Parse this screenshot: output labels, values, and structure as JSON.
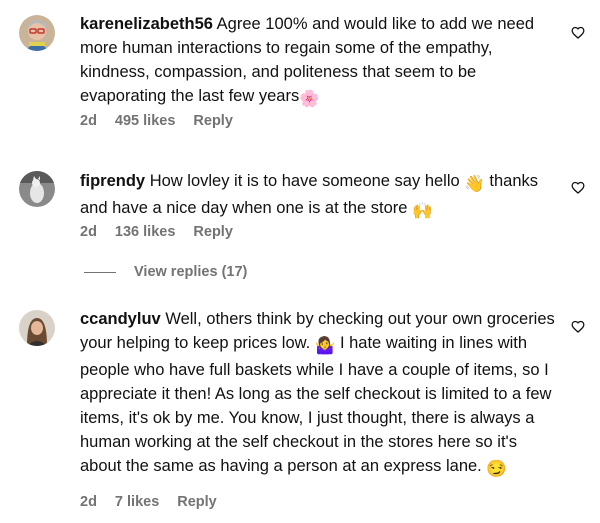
{
  "comments": [
    {
      "username": "karenelizabeth56",
      "text": "Agree 100% and would like to add we need more human interactions to regain some of the empathy, kindness, compassion, and politeness that seem to be evaporating the last few years",
      "emoji": "🌸",
      "time": "2d",
      "likes": "495 likes",
      "reply": "Reply"
    },
    {
      "username": "fiprendy",
      "text_part1": "How lovley it is to have someone say hello",
      "emoji1": "👋",
      "text_part2": "thanks and have a nice day when one is at the store",
      "emoji2": "🙌",
      "time": "2d",
      "likes": "136 likes",
      "reply": "Reply",
      "view_replies": "View replies (17)"
    },
    {
      "username": "ccandyluv",
      "text_part1": "Well, others think by checking out your own groceries your helping to keep prices low.",
      "emoji1": "🤷‍♀️",
      "text_part2": "I hate waiting in lines with people who have full baskets while I have a couple of items, so I appreciate it then! As long as the self checkout is limited to a few items, it's ok by me. You know, I just thought, there is always a human working at the self checkout in the stores here so it's about the same as having a person at an express lane.",
      "emoji2": "😏",
      "time": "2d",
      "likes": "7 likes",
      "reply": "Reply"
    }
  ],
  "icons": {
    "like": "heart-outline-icon"
  },
  "colors": {
    "meta": "#737373",
    "text": "#111111"
  }
}
